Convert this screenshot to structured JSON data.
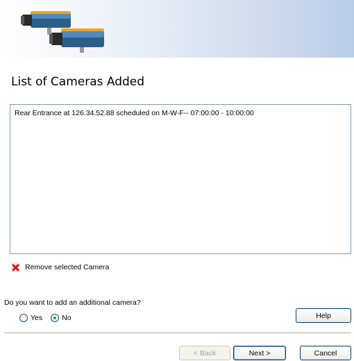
{
  "header": {
    "banner_icon": "security-cameras-icon"
  },
  "title": "List of Cameras Added",
  "camera_list": {
    "items": [
      "Rear Entrance at 126.34.52.88 scheduled on M-W-F--  07:00:00 - 10:00:00"
    ]
  },
  "remove": {
    "icon": "red-x-icon",
    "label": "Remove selected Camera"
  },
  "question": {
    "text": "Do you want to add an additional camera?",
    "options": [
      {
        "label": "Yes",
        "selected": false
      },
      {
        "label": "No",
        "selected": true
      }
    ]
  },
  "buttons": {
    "help": "Help",
    "back": "< Back",
    "next": "Next >",
    "cancel": "Cancel"
  },
  "colors": {
    "remove_icon": "#d8141c",
    "radio_selected": "#2aa92a",
    "banner_end": "#b9cde8"
  }
}
